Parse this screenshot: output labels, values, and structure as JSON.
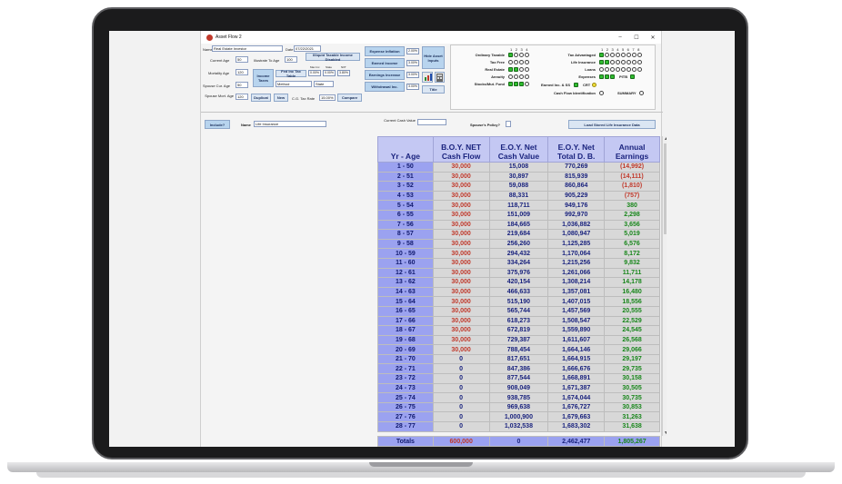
{
  "window": {
    "title": "Asset Flow 2",
    "min": "–",
    "max": "☐",
    "close": "✕"
  },
  "form": {
    "name_label": "Name",
    "name_value": "Real Estate Investor",
    "date_label": "Date",
    "date_value": "07/22/2021",
    "current_age_label": "Current Age",
    "current_age_value": "50",
    "illustrate_label": "Illustrate To Age",
    "illustrate_value": "100",
    "mortality_label": "Mortality Age",
    "mortality_value": "120",
    "spouse_age_label": "Spouse Cur. Age",
    "spouse_age_value": "50",
    "spouse_mort_label": "Spouse Mort. Age",
    "spouse_mort_value": "120",
    "taxable_btn": "Illiquid Taxable Income Disabled",
    "income_taxes_btn": "Income Taxes",
    "fed_table_btn": "Fed Inc Tax Table",
    "fed_hdr": [
      "Max Inc",
      "State",
      "NIIT"
    ],
    "fed_pcts": [
      "0.00%",
      "0.00%",
      "3.80%"
    ],
    "method_select": "Method",
    "state_select": "State",
    "duplicat_btn": "Duplicat",
    "new_btn": "New",
    "cg_label": "C.G. Tax Rate",
    "cg_value": "15.00%",
    "compare_btn": "Compare",
    "exp_inflation_btn": "Expense Inflation",
    "exp_inflation_pct": "2.00%",
    "earned_income_btn": "Earned Income",
    "earned_income_pct": "3.00%",
    "earnings_inc_btn": "Earnings Increase",
    "earnings_inc_pct": "3.00%",
    "withdrawal_btn": "Withdrawal Inc.",
    "withdrawal_pct": "3.00%",
    "hide_inputs_btn": "Hide Asset Inputs",
    "title_btn": "Title"
  },
  "assets": {
    "left_hdr": [
      "1",
      "2",
      "3",
      "4"
    ],
    "right_hdr": [
      "1",
      "2",
      "3",
      "4",
      "5",
      "6",
      "7",
      "8"
    ],
    "rows_left": [
      "Ordinary Taxable",
      "Tax Free",
      "Real Estate",
      "Annuity",
      "Stocks/Mut. Fund"
    ],
    "rows_right": [
      "Tax Advantaged",
      "Life Insurance",
      "Loans",
      "Expenses"
    ],
    "pitb_label": "PITB",
    "earned_label": "Earned Inc. & SS",
    "crt_label": "CRT",
    "cashflow_label": "Cash Flow Identification",
    "summary_label": "SUMMARY"
  },
  "policy_bar": {
    "include_btn": "Include?",
    "name_label": "Name",
    "name_value": "Life Insurance",
    "cash_label": "Current Cash Value",
    "spouse_label": "Spouse's Policy?",
    "load_btn": "Load Stored Life Insurance Data"
  },
  "table": {
    "headers": [
      [
        "Yr - Age"
      ],
      [
        "B.O.Y. NET",
        "Cash Flow"
      ],
      [
        "E.O.Y. Net",
        "Cash Value"
      ],
      [
        "E.O.Y. Net",
        "Total D. B."
      ],
      [
        "Annual",
        "Earnings"
      ]
    ],
    "rows": [
      [
        "1 - 50",
        "30,000",
        "15,008",
        "770,269",
        "(14,992)"
      ],
      [
        "2 - 51",
        "30,000",
        "30,897",
        "815,939",
        "(14,111)"
      ],
      [
        "3 - 52",
        "30,000",
        "59,088",
        "860,864",
        "(1,810)"
      ],
      [
        "4 - 53",
        "30,000",
        "88,331",
        "905,229",
        "(757)"
      ],
      [
        "5 - 54",
        "30,000",
        "118,711",
        "949,176",
        "380"
      ],
      [
        "6 - 55",
        "30,000",
        "151,009",
        "992,970",
        "2,298"
      ],
      [
        "7 - 56",
        "30,000",
        "184,665",
        "1,036,882",
        "3,656"
      ],
      [
        "8 - 57",
        "30,000",
        "219,684",
        "1,080,947",
        "5,019"
      ],
      [
        "9 - 58",
        "30,000",
        "256,260",
        "1,125,285",
        "6,576"
      ],
      [
        "10 - 59",
        "30,000",
        "294,432",
        "1,170,064",
        "8,172"
      ],
      [
        "11 - 60",
        "30,000",
        "334,264",
        "1,215,256",
        "9,832"
      ],
      [
        "12 - 61",
        "30,000",
        "375,976",
        "1,261,066",
        "11,711"
      ],
      [
        "13 - 62",
        "30,000",
        "420,154",
        "1,308,214",
        "14,178"
      ],
      [
        "14 - 63",
        "30,000",
        "466,633",
        "1,357,081",
        "16,480"
      ],
      [
        "15 - 64",
        "30,000",
        "515,190",
        "1,407,015",
        "18,556"
      ],
      [
        "16 - 65",
        "30,000",
        "565,744",
        "1,457,569",
        "20,555"
      ],
      [
        "17 - 66",
        "30,000",
        "618,273",
        "1,508,547",
        "22,529"
      ],
      [
        "18 - 67",
        "30,000",
        "672,819",
        "1,559,890",
        "24,545"
      ],
      [
        "19 - 68",
        "30,000",
        "729,387",
        "1,611,607",
        "26,568"
      ],
      [
        "20 - 69",
        "30,000",
        "788,454",
        "1,664,146",
        "29,066"
      ],
      [
        "21 - 70",
        "0",
        "817,651",
        "1,664,915",
        "29,197"
      ],
      [
        "22 - 71",
        "0",
        "847,386",
        "1,666,676",
        "29,735"
      ],
      [
        "23 - 72",
        "0",
        "877,544",
        "1,668,891",
        "30,158"
      ],
      [
        "24 - 73",
        "0",
        "908,049",
        "1,671,387",
        "30,505"
      ],
      [
        "25 - 74",
        "0",
        "938,785",
        "1,674,044",
        "30,735"
      ],
      [
        "26 - 75",
        "0",
        "969,638",
        "1,676,727",
        "30,853"
      ],
      [
        "27 - 76",
        "0",
        "1,000,900",
        "1,679,663",
        "31,263"
      ],
      [
        "28 - 77",
        "0",
        "1,032,538",
        "1,683,302",
        "31,638"
      ]
    ],
    "totals": [
      "Totals",
      "600,000",
      "0",
      "2,462,477",
      "1,805,267"
    ],
    "colors": {
      "header_bg": "#c4c8f3",
      "age_bg": "#9ba2f0",
      "red": "#c0392b",
      "green": "#18861b",
      "navy": "#1a237e"
    }
  }
}
